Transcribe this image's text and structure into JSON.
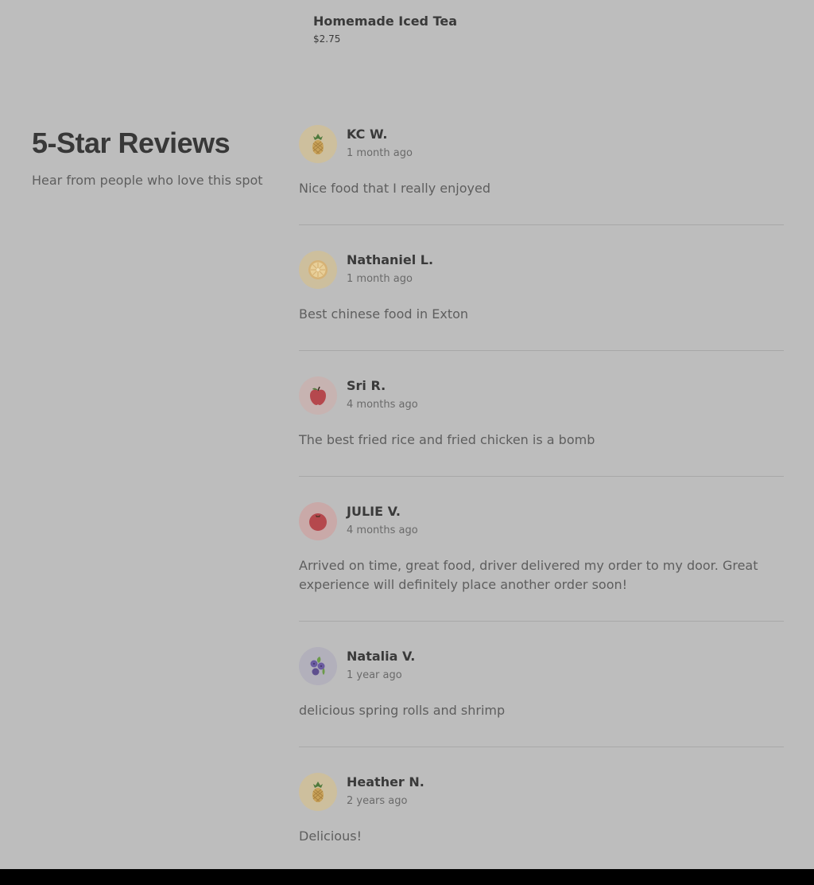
{
  "menu_item": {
    "name": "Homemade Iced Tea",
    "price": "$2.75"
  },
  "reviews_section": {
    "title": "5-Star Reviews",
    "subtitle": "Hear from people who love this spot"
  },
  "reviews": [
    {
      "name": "KC W.",
      "date": "1 month ago",
      "text": "Nice food that I really enjoyed",
      "avatar": "pineapple-icon",
      "avatar_bg": "#cdbf9d"
    },
    {
      "name": "Nathaniel L.",
      "date": "1 month ago",
      "text": "Best chinese food in Exton",
      "avatar": "orange-slice-icon",
      "avatar_bg": "#cdbf9d"
    },
    {
      "name": "Sri R.",
      "date": "4 months ago",
      "text": "The best fried rice and fried chicken is a bomb",
      "avatar": "apple-icon",
      "avatar_bg": "#c7b3b1"
    },
    {
      "name": "JULIE V.",
      "date": "4 months ago",
      "text": "Arrived on time, great food, driver delivered my order to my door. Great experience will definitely place another order soon!",
      "avatar": "tomato-icon",
      "avatar_bg": "#c9a9a8"
    },
    {
      "name": "Natalia V.",
      "date": "1 year ago",
      "text": "delicious spring rolls and shrimp",
      "avatar": "blueberries-icon",
      "avatar_bg": "#b2b0bb"
    },
    {
      "name": "Heather N.",
      "date": "2 years ago",
      "text": "Delicious!",
      "avatar": "pineapple-icon",
      "avatar_bg": "#cdbf9d"
    }
  ]
}
